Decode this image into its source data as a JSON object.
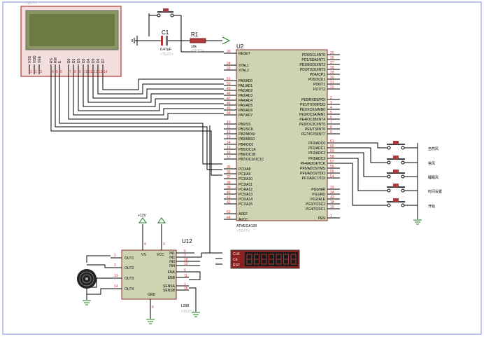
{
  "sheet": {
    "text_placeholder": "<TEXT>"
  },
  "lcd": {
    "pins": [
      "VSS",
      "VDD",
      "VEE",
      "RS",
      "RW",
      "E",
      "D0",
      "D1",
      "D2",
      "D3",
      "D4",
      "D5",
      "D6",
      "D7"
    ],
    "pin_numbers": [
      "1",
      "2",
      "3",
      "4",
      "5",
      "6",
      "7",
      "8",
      "9",
      "10",
      "11",
      "12",
      "13",
      "14"
    ]
  },
  "c1": {
    "ref": "C1",
    "value": "0.47uF",
    "placeholder": "<TEXT>"
  },
  "r1": {
    "ref": "R1",
    "value": "10k",
    "placeholder": "<TEXT>"
  },
  "u2": {
    "ref": "U2",
    "part": "ATMEGA128",
    "placeholder": "<TEXT>",
    "left_pins": [
      {
        "num": "20",
        "name": "RESET"
      },
      {
        "num": "24",
        "name": "XTAL1"
      },
      {
        "num": "23",
        "name": "XTAL2"
      },
      {
        "num": "51",
        "name": "PA0/AD0"
      },
      {
        "num": "50",
        "name": "PA1/AD1"
      },
      {
        "num": "49",
        "name": "PA2/AD2"
      },
      {
        "num": "48",
        "name": "PA3/AD3"
      },
      {
        "num": "47",
        "name": "PA4/AD4"
      },
      {
        "num": "46",
        "name": "PA5/AD5"
      },
      {
        "num": "45",
        "name": "PA6/AD6"
      },
      {
        "num": "44",
        "name": "PA7/AD7"
      },
      {
        "num": "10",
        "name": "PB0/SS"
      },
      {
        "num": "11",
        "name": "PB1/SCK"
      },
      {
        "num": "12",
        "name": "PB2/MOSI"
      },
      {
        "num": "13",
        "name": "PB3/MISO"
      },
      {
        "num": "14",
        "name": "PB4/OC0"
      },
      {
        "num": "15",
        "name": "PB5/OC1A"
      },
      {
        "num": "16",
        "name": "PB6/OC1B"
      },
      {
        "num": "17",
        "name": "PB7/OC2/OC1C"
      },
      {
        "num": "35",
        "name": "PC0/A8"
      },
      {
        "num": "36",
        "name": "PC1/A9"
      },
      {
        "num": "37",
        "name": "PC2/A10"
      },
      {
        "num": "38",
        "name": "PC3/A11"
      },
      {
        "num": "39",
        "name": "PC4/A12"
      },
      {
        "num": "40",
        "name": "PC5/A13"
      },
      {
        "num": "41",
        "name": "PC6/A14"
      },
      {
        "num": "42",
        "name": "PC7/A15"
      },
      {
        "num": "62",
        "name": "AREF"
      },
      {
        "num": "64",
        "name": "AVCC"
      }
    ],
    "right_pins": [
      {
        "num": "25",
        "name": "PD0/SCL/INT0"
      },
      {
        "num": "26",
        "name": "PD1/SDA/INT1"
      },
      {
        "num": "27",
        "name": "PD2/RXD1/INT2"
      },
      {
        "num": "28",
        "name": "PD3/TXD1/INT3"
      },
      {
        "num": "29",
        "name": "PD4/ICP1"
      },
      {
        "num": "30",
        "name": "PD5/XCK1"
      },
      {
        "num": "31",
        "name": "PD6/T1"
      },
      {
        "num": "32",
        "name": "PD7/T2"
      },
      {
        "num": "2",
        "name": "PE0/RXD0/PDI"
      },
      {
        "num": "3",
        "name": "PE1/TXD0/PDO"
      },
      {
        "num": "4",
        "name": "PE2/XCK0/AIN0"
      },
      {
        "num": "5",
        "name": "PE3/OC3A/AIN1"
      },
      {
        "num": "6",
        "name": "PE4/OC3B/INT4"
      },
      {
        "num": "7",
        "name": "PE5/OC3C/INT5"
      },
      {
        "num": "8",
        "name": "PE6/T3/INT6"
      },
      {
        "num": "9",
        "name": "PE7/ICP3/INT7"
      },
      {
        "num": "61",
        "name": "PF0/ADC0"
      },
      {
        "num": "60",
        "name": "PF1/ADC1"
      },
      {
        "num": "59",
        "name": "PF2/ADC2"
      },
      {
        "num": "58",
        "name": "PF3/ADC3"
      },
      {
        "num": "57",
        "name": "PF4/ADC4/TCK"
      },
      {
        "num": "56",
        "name": "PF5/ADC5/TMS"
      },
      {
        "num": "55",
        "name": "PF6/ADC6/TDO"
      },
      {
        "num": "54",
        "name": "PF7/ADC7/TDI"
      },
      {
        "num": "33",
        "name": "PG0/WR"
      },
      {
        "num": "34",
        "name": "PG1/RD"
      },
      {
        "num": "43",
        "name": "PG2/ALE"
      },
      {
        "num": "18",
        "name": "PG3/TOSC2"
      },
      {
        "num": "19",
        "name": "PG4/TOSC1"
      },
      {
        "num": "1",
        "name": "PEN"
      }
    ]
  },
  "buttons": [
    {
      "label": "自然风"
    },
    {
      "label": "常风"
    },
    {
      "label": "睡眠风"
    },
    {
      "label": "时间设置"
    },
    {
      "label": "开始"
    }
  ],
  "u12": {
    "ref": "U12",
    "part": "L298",
    "placeholder": "<TEXT>",
    "supply_label": "+12V",
    "left_pins": [
      {
        "num": "2",
        "name": "OUT1"
      },
      {
        "num": "3",
        "name": "OUT2"
      },
      {
        "num": "13",
        "name": "OUT3"
      },
      {
        "num": "14",
        "name": "OUT4"
      }
    ],
    "right_pins": [
      {
        "num": "5",
        "name": "IN1"
      },
      {
        "num": "7",
        "name": "IN2"
      },
      {
        "num": "10",
        "name": "IN3"
      },
      {
        "num": "12",
        "name": "IN4"
      },
      {
        "num": "6",
        "name": "ENA"
      },
      {
        "num": "11",
        "name": "ENB"
      },
      {
        "num": "1",
        "name": "SENSA"
      },
      {
        "num": "15",
        "name": "SENSB"
      }
    ],
    "vs": {
      "num": "4",
      "name": "VS"
    },
    "vcc": {
      "num": "9",
      "name": "VCC"
    },
    "gnd": {
      "num": "8",
      "name": "GND"
    }
  },
  "display": {
    "pins": [
      "CLK",
      "CE",
      "RST"
    ]
  }
}
